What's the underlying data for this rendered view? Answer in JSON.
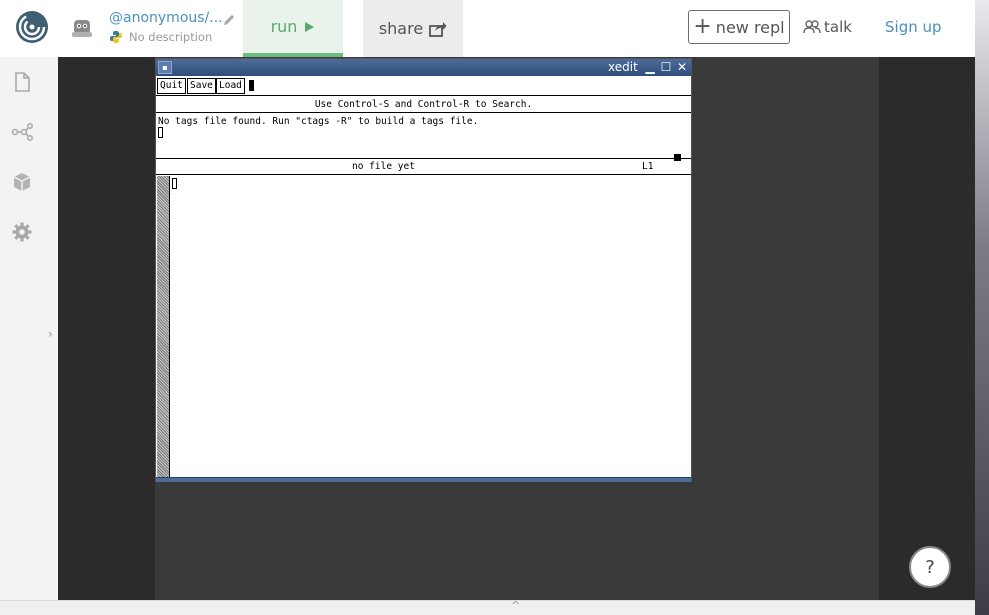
{
  "header": {
    "owner": "@anonymous/...",
    "description": "No description",
    "run_label": "run",
    "share_label": "share",
    "new_repl_label": "new repl",
    "talk_label": "talk",
    "signup_label": "Sign up",
    "accent_color": "#6cbe7e",
    "link_color": "#4a90c2"
  },
  "sidebar": {
    "icons": [
      "file-icon",
      "share-graph-icon",
      "package-icon",
      "gear-icon"
    ],
    "collapse_glyph": "›"
  },
  "xedit": {
    "title": "xedit",
    "buttons": [
      "Quit",
      "Save",
      "Load"
    ],
    "search_hint": "Use Control-S and Control-R to Search.",
    "message": "No tags file found. Run \"ctags -R\" to build a tags file.",
    "status_file": "no file yet",
    "status_line": "L1",
    "title_color": "#3d5d8c"
  },
  "help_label": "?",
  "bottom_glyph": "^"
}
